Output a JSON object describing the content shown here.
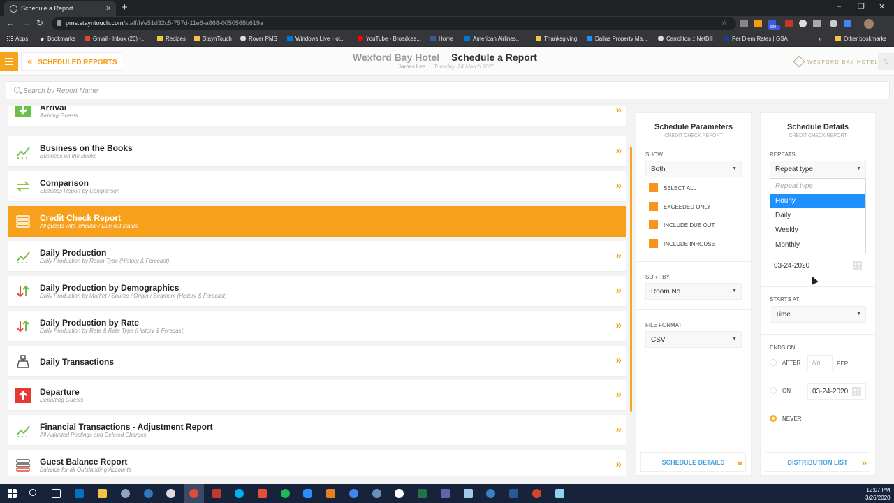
{
  "browser": {
    "tab_title": "Schedule a Report",
    "url_host": "pms.stayntouch.com",
    "url_path": "/staff/h/e51d32c5-757d-11e6-a868-0050568b619a",
    "bookmarks": [
      "Apps",
      "Bookmarks",
      "Gmail - Inbox (26) -...",
      "Recipes",
      "StaynTouch",
      "Rover PMS",
      "Windows Live Hot...",
      "YouTube - Broadcas...",
      "Home",
      "American Airlines...",
      "Thanksgiving",
      "Dallas Property Ma...",
      "Carrollton :: NetBill",
      "Per Diem Rates | GSA"
    ],
    "other_bookmarks": "Other bookmarks",
    "new_tab": "+",
    "close_tab": "×",
    "overflow": "»",
    "mail_badge": "999+"
  },
  "header": {
    "back_label": "SCHEDULED REPORTS",
    "hotel_name": "Wexford Bay Hotel",
    "page_title": "Schedule a Report",
    "user_name": "James Lee",
    "date": "Tuesday, 24 March 2020",
    "logo_text": "WEXFORD BAY HOTEL"
  },
  "search": {
    "placeholder": "Search by Report Name"
  },
  "reports": [
    {
      "title": "Arrival",
      "subtitle": "Arriving Guests",
      "icon": "arrival-down-arrow-icon"
    },
    {
      "title": "Business on the Books",
      "subtitle": "Business on the Books",
      "icon": "trend-chart-icon"
    },
    {
      "title": "Comparison",
      "subtitle": "Statistics Report by Comparison",
      "icon": "compare-arrows-icon"
    },
    {
      "title": "Credit Check Report",
      "subtitle": "All guests with Inhouse / Due out status",
      "icon": "credit-stack-icon"
    },
    {
      "title": "Daily Production",
      "subtitle": "Daily Production by Room Type (History & Forecast)",
      "icon": "trend-chart-icon"
    },
    {
      "title": "Daily Production by Demographics",
      "subtitle": "Daily Production by Market / Source / Origin / Segment (History & Forecast)",
      "icon": "up-down-arrows-icon"
    },
    {
      "title": "Daily Production by Rate",
      "subtitle": "Daily Production by Rate & Rate Type (History & Forecast)",
      "icon": "up-down-arrows-icon"
    },
    {
      "title": "Daily Transactions",
      "subtitle": "",
      "icon": "cash-register-icon"
    },
    {
      "title": "Departure",
      "subtitle": "Departing Guests",
      "icon": "departure-up-arrow-icon"
    },
    {
      "title": "Financial Transactions - Adjustment Report",
      "subtitle": "All Adjusted Postings and Deleted Charges",
      "icon": "trend-chart-icon"
    },
    {
      "title": "Guest Balance Report",
      "subtitle": "Balance for all Outstanding Accounts",
      "icon": "credit-stack-icon"
    }
  ],
  "params": {
    "title": "Schedule Parameters",
    "subtitle": "CREDIT CHECK REPORT",
    "show_label": "SHOW",
    "show_value": "Both",
    "checkboxes": [
      "SELECT ALL",
      "EXCEEDED ONLY",
      "INCLUDE DUE OUT",
      "INCLUDE INHOUSE"
    ],
    "sort_label": "SORT BY",
    "sort_value": "Room No",
    "format_label": "FILE FORMAT",
    "format_value": "CSV",
    "button": "SCHEDULE DETAILS"
  },
  "details": {
    "title": "Schedule Details",
    "subtitle": "CREDIT CHECK REPORT",
    "repeats_label": "REPEATS",
    "repeats_value": "Repeat type",
    "options": [
      "Repeat type",
      "Hourly",
      "Daily",
      "Weekly",
      "Monthly"
    ],
    "highlighted_option": "Hourly",
    "start_date": "03-24-2020",
    "starts_at_label": "STARTS AT",
    "starts_at_value": "Time",
    "ends_on_label": "ENDS ON",
    "after_label": "AFTER",
    "after_placeholder": "No.",
    "per_label": "PER",
    "on_label": "ON",
    "on_date": "03-24-2020",
    "never_label": "NEVER",
    "selected_end": "NEVER",
    "button": "DISTRIBUTION LIST"
  },
  "taskbar": {
    "time": "12:07 PM",
    "date": "3/26/2020"
  },
  "colors": {
    "accent": "#f7a01b",
    "link": "#4aa3df",
    "highlight": "#1e90ff"
  }
}
